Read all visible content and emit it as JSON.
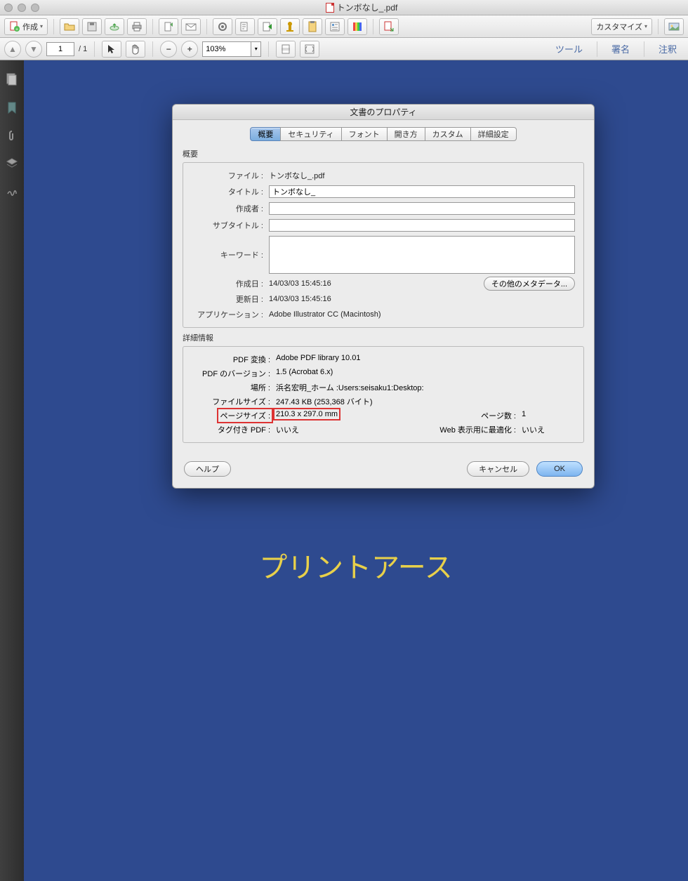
{
  "window": {
    "title": "トンボなし_.pdf"
  },
  "toolbar1": {
    "create": "作成",
    "customize": "カスタマイズ"
  },
  "toolbar2": {
    "page_current": "1",
    "page_total": "/ 1",
    "zoom": "103%",
    "tool": "ツール",
    "sign": "署名",
    "comment": "注釈"
  },
  "document": {
    "page_text": "プリントアース"
  },
  "dialog": {
    "title": "文書のプロパティ",
    "tabs": {
      "summary": "概要",
      "security": "セキュリティ",
      "font": "フォント",
      "open": "開き方",
      "custom": "カスタム",
      "advanced": "詳細設定"
    },
    "section_summary": "概要",
    "fields": {
      "file_label": "ファイル :",
      "file_value": "トンボなし_.pdf",
      "title_label": "タイトル :",
      "title_value": "トンボなし_",
      "author_label": "作成者 :",
      "author_value": "",
      "subtitle_label": "サブタイトル :",
      "subtitle_value": "",
      "keywords_label": "キーワード :",
      "keywords_value": "",
      "created_label": "作成日 :",
      "created_value": "14/03/03 15:45:16",
      "modified_label": "更新日 :",
      "modified_value": "14/03/03 15:45:16",
      "app_label": "アプリケーション :",
      "app_value": "Adobe Illustrator CC (Macintosh)",
      "meta_button": "その他のメタデータ..."
    },
    "section_details": "詳細情報",
    "details": {
      "pdf_producer_label": "PDF 変換 :",
      "pdf_producer_value": "Adobe PDF library 10.01",
      "pdf_version_label": "PDF のバージョン :",
      "pdf_version_value": "1.5 (Acrobat 6.x)",
      "location_label": "場所 :",
      "location_value": "浜名宏明_ホーム :Users:seisaku1:Desktop:",
      "filesize_label": "ファイルサイズ :",
      "filesize_value": "247.43 KB (253,368 バイト)",
      "pagesize_label": "ページサイズ :",
      "pagesize_value": "210.3 x 297.0 mm",
      "pagecount_label": "ページ数 :",
      "pagecount_value": "1",
      "tagged_label": "タグ付き PDF :",
      "tagged_value": "いいえ",
      "webopt_label": "Web 表示用に最適化 :",
      "webopt_value": "いいえ"
    },
    "buttons": {
      "help": "ヘルプ",
      "cancel": "キャンセル",
      "ok": "OK"
    }
  }
}
